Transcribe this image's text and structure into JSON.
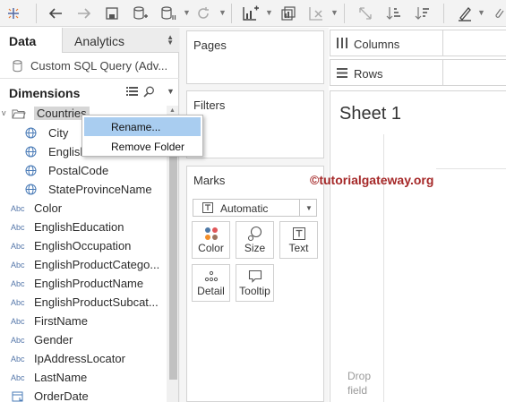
{
  "data_pane": {
    "tab_data": "Data",
    "tab_analytics": "Analytics",
    "datasource": "Custom SQL Query (Adv...",
    "dimensions_header": "Dimensions",
    "fields": [
      {
        "label": "Countries",
        "kind": "folder"
      },
      {
        "label": "City",
        "kind": "geo"
      },
      {
        "label": "English",
        "kind": "geo"
      },
      {
        "label": "PostalCode",
        "kind": "geo"
      },
      {
        "label": "StateProvinceName",
        "kind": "geo"
      },
      {
        "label": "Color",
        "kind": "abc"
      },
      {
        "label": "EnglishEducation",
        "kind": "abc"
      },
      {
        "label": "EnglishOccupation",
        "kind": "abc"
      },
      {
        "label": "EnglishProductCatego...",
        "kind": "abc"
      },
      {
        "label": "EnglishProductName",
        "kind": "abc"
      },
      {
        "label": "EnglishProductSubcat...",
        "kind": "abc"
      },
      {
        "label": "FirstName",
        "kind": "abc"
      },
      {
        "label": "Gender",
        "kind": "abc"
      },
      {
        "label": "IpAddressLocator",
        "kind": "abc"
      },
      {
        "label": "LastName",
        "kind": "abc"
      },
      {
        "label": "OrderDate",
        "kind": "date"
      }
    ],
    "abc_badge": "Abc"
  },
  "context_menu": {
    "items": [
      "Rename...",
      "Remove Folder"
    ]
  },
  "shelves": {
    "pages": "Pages",
    "filters": "Filters",
    "marks": "Marks",
    "mark_type": "Automatic",
    "mark_buttons": [
      "Color",
      "Size",
      "Text",
      "Detail",
      "Tooltip"
    ],
    "columns": "Columns",
    "rows": "Rows"
  },
  "view": {
    "sheet_title": "Sheet 1",
    "drop_line1": "Drop",
    "drop_line2": "field"
  },
  "watermark": "©tutorialgateway.org",
  "colors": {
    "highlight": "#a9cdf0",
    "watermark": "#a52828",
    "folder_bg": "#d6d6d6"
  }
}
